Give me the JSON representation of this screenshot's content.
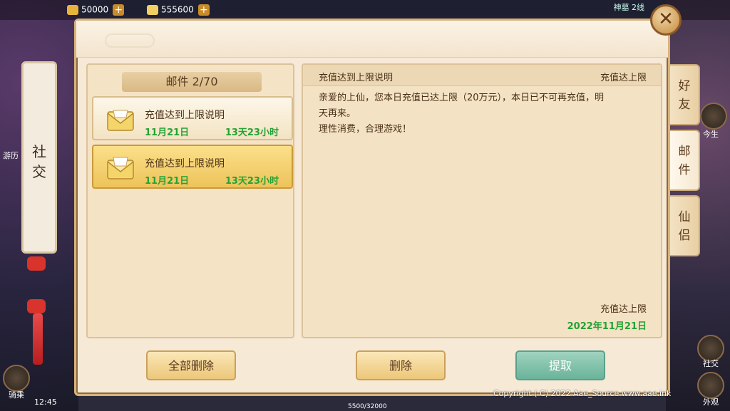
{
  "topbar": {
    "gold": "50000",
    "ingot": "555600",
    "map_label": "神墓 2线"
  },
  "left_banner": {
    "text_line1": "社",
    "text_line2": "交"
  },
  "mail_list": {
    "header": "邮件 2/70",
    "items": [
      {
        "title": "充值达到上限说明",
        "date": "11月21日",
        "remaining": "13天23小时",
        "selected": false
      },
      {
        "title": "充值达到上限说明",
        "date": "11月21日",
        "remaining": "13天23小时",
        "selected": true
      }
    ]
  },
  "detail": {
    "title": "充值达到上限说明",
    "sender": "充值达上限",
    "body_line1": "亲爱的上仙，您本日充值已达上限（20万元），本日已不可再充值，明",
    "body_line2": "天再来。",
    "body_line3": "理性消费，合理游戏！",
    "sign_name": "充值达上限",
    "sign_date": "2022年11月21日"
  },
  "buttons": {
    "delete_all": "全部删除",
    "delete": "删除",
    "claim": "提取"
  },
  "tabs": [
    {
      "label_1": "好",
      "label_2": "友"
    },
    {
      "label_1": "邮",
      "label_2": "件"
    },
    {
      "label_1": "仙",
      "label_2": "侣"
    }
  ],
  "side": {
    "right_label_1": "今生",
    "right_label_2": "社交",
    "right_label_3": "外观",
    "left_label_1": "游历",
    "left_label_2": "骑乘",
    "time": "12:45",
    "exp": "5500/32000"
  },
  "copyright": "Copyright ( C) 2022 Aae_Source www.aae.ink",
  "colors": {
    "panel_bg": "#f6e9d6",
    "accent_green": "#23a334",
    "selected_item": "#eec35a",
    "claim_button": "#6ab39a"
  }
}
